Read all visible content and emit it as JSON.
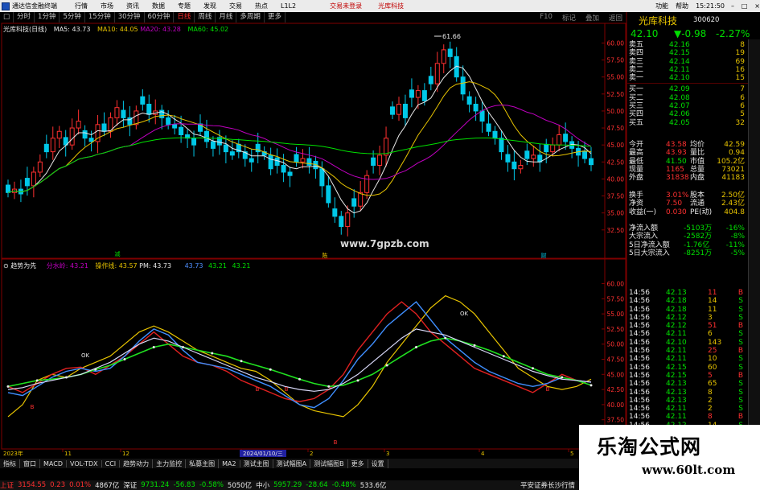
{
  "titlebar": {
    "app_name": "通达信金融终端",
    "menus": [
      "行情",
      "市场",
      "资讯",
      "数据",
      "专题",
      "发现",
      "交易",
      "热点",
      "L1L2"
    ],
    "trade_login": "交易未登录",
    "stock_name": "光库科技",
    "right_menus": [
      "功能",
      "帮助",
      "15:21:50"
    ]
  },
  "periodbar": {
    "items": [
      "□",
      "分时",
      "1分钟",
      "5分钟",
      "15分钟",
      "30分钟",
      "60分钟",
      "日线",
      "周线",
      "月线",
      "多周期",
      "更多"
    ],
    "active": "日线",
    "right_items": [
      "F10",
      "标记",
      "叠加",
      "返回"
    ]
  },
  "kline": {
    "legend_title": "光库科技(日线)",
    "ma5": "MA5: 43.73",
    "ma10": "MA10: 44.05",
    "ma20": "MA20: 43.28",
    "ma60": "MA60: 45.02",
    "y_ticks": [
      "60.00",
      "57.50",
      "55.00",
      "52.50",
      "50.00",
      "47.50",
      "45.00",
      "42.50",
      "40.00",
      "37.50",
      "35.00",
      "32.50"
    ],
    "high_label": "61.66",
    "watermark": "www.7gpzb.com",
    "marker_left": "减",
    "marker_mid": "陈",
    "marker_right": "财"
  },
  "indicator": {
    "name": "趋势为先",
    "l1": "分水岭: 43.21",
    "l2": "操作线: 43.57",
    "l3": "PM: 43.73",
    "l4": "43.73",
    "l5": "43.21",
    "l6": "43.21",
    "y_ticks": [
      "60.00",
      "57.50",
      "55.00",
      "52.50",
      "50.00",
      "47.50",
      "45.00",
      "42.50",
      "40.00",
      "37.50",
      "35.00"
    ],
    "ok_label": "OK",
    "b_label": "B"
  },
  "timeaxis": {
    "year": "2023年",
    "labels": [
      "11",
      "12",
      "2024/01/10/三",
      "2",
      "3",
      "4",
      "5"
    ]
  },
  "stock": {
    "name": "光库科技",
    "code": "300620",
    "price": "42.10",
    "change": "▼-0.98",
    "pct": "-2.27%"
  },
  "orderbook": {
    "asks": [
      {
        "label": "卖五",
        "price": "42.16",
        "vol": "8"
      },
      {
        "label": "卖四",
        "price": "42.15",
        "vol": "19"
      },
      {
        "label": "卖三",
        "price": "42.14",
        "vol": "69"
      },
      {
        "label": "卖二",
        "price": "42.11",
        "vol": "16"
      },
      {
        "label": "卖一",
        "price": "42.10",
        "vol": "15"
      }
    ],
    "bids": [
      {
        "label": "买一",
        "price": "42.09",
        "vol": "7"
      },
      {
        "label": "买二",
        "price": "42.08",
        "vol": "6"
      },
      {
        "label": "买三",
        "price": "42.07",
        "vol": "6"
      },
      {
        "label": "买四",
        "price": "42.06",
        "vol": "5"
      },
      {
        "label": "买五",
        "price": "42.05",
        "vol": "32"
      }
    ]
  },
  "stats": [
    {
      "k1": "今开",
      "v1": "43.58",
      "k2": "均价",
      "v2": "42.59"
    },
    {
      "k1": "最高",
      "v1": "43.93",
      "k2": "量比",
      "v2": "0.94"
    },
    {
      "k1": "最低",
      "v1": "41.50",
      "k2": "市值",
      "v2": "105.2亿"
    },
    {
      "k1": "现量",
      "v1": "1165",
      "k2": "总量",
      "v2": "73021"
    },
    {
      "k1": "外盘",
      "v1": "31838",
      "k2": "内盘",
      "v2": "41183"
    }
  ],
  "stats2": [
    {
      "k1": "换手",
      "v1": "3.01%",
      "k2": "股本",
      "v2": "2.50亿"
    },
    {
      "k1": "净资",
      "v1": "7.50",
      "k2": "流通",
      "v2": "2.43亿"
    },
    {
      "k1": "收益(一)",
      "v1": "0.030",
      "k2": "PE(动)",
      "v2": "404.8"
    }
  ],
  "flows": [
    {
      "k": "净流入额",
      "v": "-5103万",
      "p": "-16%"
    },
    {
      "k": "大宗流入",
      "v": "-2582万",
      "p": "-8%"
    },
    {
      "k": "5日净流入额",
      "v": "-1.76亿",
      "p": "-11%"
    },
    {
      "k": "5日大宗流入",
      "v": "-8251万",
      "p": "-5%"
    }
  ],
  "ticks": [
    {
      "t": "14:56",
      "p": "42.13",
      "v": "11",
      "s": "B"
    },
    {
      "t": "14:56",
      "p": "42.18",
      "v": "14",
      "s": "S"
    },
    {
      "t": "14:56",
      "p": "42.18",
      "v": "11",
      "s": "S"
    },
    {
      "t": "14:56",
      "p": "42.12",
      "v": "3",
      "s": "S"
    },
    {
      "t": "14:56",
      "p": "42.12",
      "v": "51",
      "s": "B"
    },
    {
      "t": "14:56",
      "p": "42.11",
      "v": "6",
      "s": "S"
    },
    {
      "t": "14:56",
      "p": "42.10",
      "v": "143",
      "s": "S"
    },
    {
      "t": "14:56",
      "p": "42.11",
      "v": "25",
      "s": "B"
    },
    {
      "t": "14:56",
      "p": "42.11",
      "v": "10",
      "s": "S"
    },
    {
      "t": "14:56",
      "p": "42.15",
      "v": "60",
      "s": "S"
    },
    {
      "t": "14:56",
      "p": "42.15",
      "v": "5",
      "s": "B"
    },
    {
      "t": "14:56",
      "p": "42.13",
      "v": "65",
      "s": "S"
    },
    {
      "t": "14:56",
      "p": "42.13",
      "v": "8",
      "s": "S"
    },
    {
      "t": "14:56",
      "p": "42.13",
      "v": "2",
      "s": "S"
    },
    {
      "t": "14:56",
      "p": "42.11",
      "v": "2",
      "s": "S"
    },
    {
      "t": "14:56",
      "p": "42.11",
      "v": "8",
      "s": "B"
    },
    {
      "t": "14:56",
      "p": "42.12",
      "v": "14",
      "s": "S"
    }
  ],
  "bottombar": [
    "指标",
    "窗口",
    "MACD",
    "VOL-TDX",
    "CCI",
    "趋势动力",
    "主力监控",
    "私募主图",
    "MA2",
    "测试主图",
    "测试幅图A",
    "测试幅图B",
    "更多",
    "设置"
  ],
  "statusbar": {
    "sh_label": "上证",
    "sh_val": "3154.55",
    "sh_chg": "0.23",
    "sh_pct": "0.01%",
    "sh_amt": "4867亿",
    "sz_label": "深证",
    "sz_val": "9731.24",
    "sz_chg": "-56.83",
    "sz_pct": "-0.58%",
    "sz_amt": "5050亿",
    "zx_label": "中小",
    "zx_val": "5957.29",
    "zx_chg": "-28.64",
    "zx_pct": "-0.48%",
    "zx_amt": "533.6亿",
    "broker": "平安证券长沙行情"
  },
  "brand": {
    "cn": "乐淘公式网",
    "url": "www.60lt.com"
  },
  "colors": {
    "up": "#ff3030",
    "down": "#00c8e8",
    "ma5": "#e8e8e8",
    "ma10": "#e8c400",
    "ma20": "#c000c0",
    "ma60": "#00e000"
  }
}
